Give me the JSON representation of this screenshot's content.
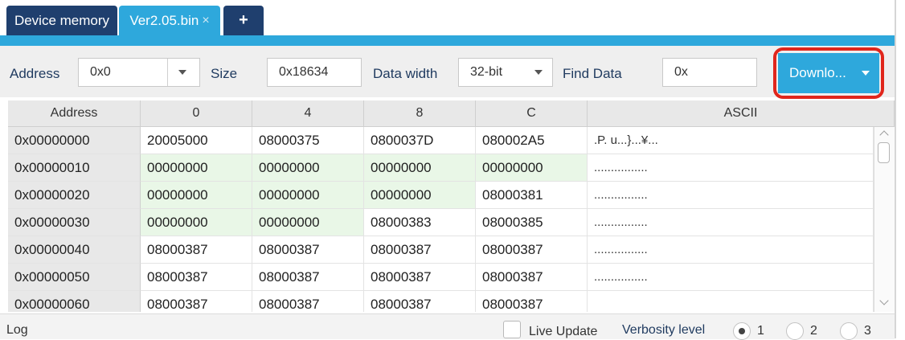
{
  "tabs": [
    {
      "label": "Device memory"
    },
    {
      "label": "Ver2.05.bin",
      "close": "×"
    },
    {
      "label": "+"
    }
  ],
  "toolbar": {
    "address_label": "Address",
    "address_value": "0x0",
    "size_label": "Size",
    "size_value": "0x18634",
    "data_width_label": "Data width",
    "data_width_value": "32-bit",
    "find_label": "Find Data",
    "find_value": "0x",
    "download_label": "Downlo...",
    "accent_color": "#2ea8dc",
    "highlight_color": "#e0261c"
  },
  "table": {
    "columns": [
      "Address",
      "0",
      "4",
      "8",
      "C",
      "ASCII"
    ],
    "rows": [
      {
        "addr": "0x00000000",
        "c0": "20005000",
        "c4": "08000375",
        "c8": "0800037D",
        "cC": "080002A5",
        "ascii": ".P. u...}...¥..."
      },
      {
        "addr": "0x00000010",
        "c0": "00000000",
        "c4": "00000000",
        "c8": "00000000",
        "cC": "00000000",
        "ascii": "................"
      },
      {
        "addr": "0x00000020",
        "c0": "00000000",
        "c4": "00000000",
        "c8": "00000000",
        "cC": "08000381",
        "ascii": "................"
      },
      {
        "addr": "0x00000030",
        "c0": "00000000",
        "c4": "00000000",
        "c8": "08000383",
        "cC": "08000385",
        "ascii": "................"
      },
      {
        "addr": "0x00000040",
        "c0": "08000387",
        "c4": "08000387",
        "c8": "08000387",
        "cC": "08000387",
        "ascii": "................"
      },
      {
        "addr": "0x00000050",
        "c0": "08000387",
        "c4": "08000387",
        "c8": "08000387",
        "cC": "08000387",
        "ascii": "................"
      },
      {
        "addr": "0x00000060",
        "c0": "08000387",
        "c4": "08000387",
        "c8": "08000387",
        "cC": "08000387",
        "ascii": ""
      }
    ],
    "zero_highlight_color": "#e9f7e7"
  },
  "log": {
    "label": "Log",
    "live_update_label": "Live Update",
    "live_update_checked": false,
    "verbosity_label": "Verbosity level",
    "levels": [
      "1",
      "2",
      "3"
    ],
    "selected_level": "1"
  }
}
